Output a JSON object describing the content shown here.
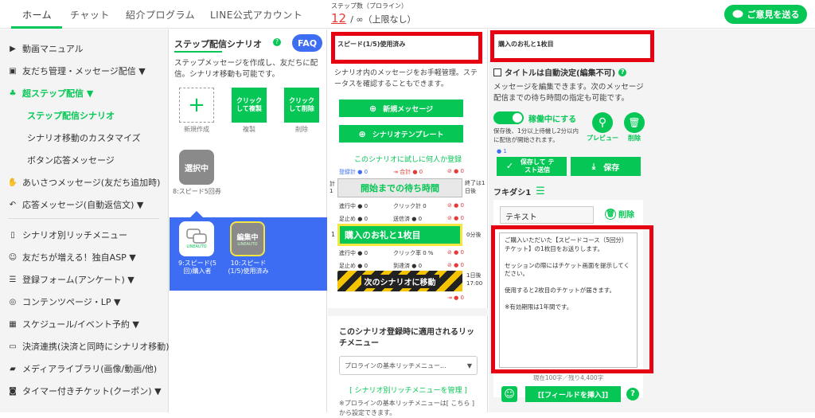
{
  "top_nav": {
    "tabs": [
      {
        "label": "ホーム"
      },
      {
        "label": "チャット"
      },
      {
        "label": "紹介プログラム"
      },
      {
        "label": "LINE公式アカウント"
      }
    ],
    "step_count": {
      "label": "ステップ数（プロライン）",
      "current": "12",
      "separator": "/ ∞（上限なし）"
    },
    "feedback_label": "ご意見を送る"
  },
  "sidebar": {
    "items": [
      {
        "label": "動画マニュアル",
        "icon": "video-icon"
      },
      {
        "label": "友だち管理・メッセージ配信 ▼",
        "icon": "contact-icon"
      },
      {
        "label": "超ステップ配信 ▼",
        "icon": "tree-icon"
      },
      {
        "label": "あいさつメッセージ(友だち追加時)",
        "icon": "hand-icon"
      },
      {
        "label": "応答メッセージ(自動返信文) ▼",
        "icon": "reply-icon"
      },
      {
        "label": "シナリオ別リッチメニュー",
        "icon": "phone-icon"
      },
      {
        "label": "友だちが増える！独自ASP ▼",
        "icon": "affiliate-icon"
      },
      {
        "label": "登録フォーム(アンケート) ▼",
        "icon": "list-icon"
      },
      {
        "label": "コンテンツページ・LP ▼",
        "icon": "globe-icon"
      },
      {
        "label": "スケジュール/イベント予約 ▼",
        "icon": "calendar-icon"
      },
      {
        "label": "決済連携(決済と同時にシナリオ移動) ▼",
        "icon": "card-icon"
      },
      {
        "label": "メディアライブラリ(画像/動画/他)",
        "icon": "folder-icon"
      },
      {
        "label": "タイマー付きチケット(クーポン) ▼",
        "icon": "ticket-icon"
      }
    ],
    "subitems": [
      {
        "label": "ステップ配信シナリオ"
      },
      {
        "label": "シナリオ移動のカスタマイズ"
      },
      {
        "label": "ボタン応答メッセージ"
      }
    ]
  },
  "scenario_panel": {
    "title": "ステップ配信シナリオ",
    "faq_label": "FAQ",
    "description": "ステップメッセージを作成し、友だちに配信。シナリオ移動も可能です。",
    "new_label": "新規作成",
    "copy_label": "クリックして複製",
    "copy_caption": "複製",
    "delete_label": "クリックして削除",
    "delete_caption": "削除",
    "selected_tile_label": "選択中",
    "selected_tile_caption": "8:スピード5回券",
    "tiles": [
      {
        "caption": "9:スピード(5回)購入者",
        "badge": "LINEAUTO"
      },
      {
        "caption": "10:スピード(1/5)使用済み",
        "badge": "LINEAUTO",
        "overlay": "編集中"
      }
    ]
  },
  "message_panel": {
    "name_value": "スピード(1/5)使用済み",
    "description": "シナリオ内のメッセージをお手軽管理。ステータスを確認することもできます。",
    "new_message_label": "新規メッセージ",
    "template_label": "シナリオテンプレート",
    "test_register_label": "このシナリオに試しに何人か登録",
    "stats_row1": {
      "registered": "登録計",
      "registered_val": "0",
      "total": "合計",
      "total_val": "0",
      "blocked_val": "0"
    },
    "wait_label": "開始までの待ち時間",
    "wait_left": "計1",
    "wait_right": "終了は1日後",
    "stats_row2": {
      "progress": "進行中",
      "progress_val": "0",
      "click": "クリック計",
      "click_val": "0",
      "blocked_val": "0"
    },
    "stats_row3": {
      "stop": "足止め",
      "stop_val": "0",
      "sent": "送信済",
      "sent_val": "0",
      "blocked_val": "0"
    },
    "step1_label": "購入のお礼と1枚目",
    "step1_left": "1",
    "step1_right": "0分後",
    "stats_row4": {
      "progress": "進行中",
      "progress_val": "0",
      "click_rate": "クリック率",
      "click_rate_val": "0 %",
      "blocked_val": "0"
    },
    "stats_row5": {
      "stop": "足止め",
      "stop_val": "0",
      "reach": "到達済",
      "reach_val": "0",
      "blocked_val": "0"
    },
    "next_scenario_label": "次のシナリオに移動",
    "next_right": "1日後17:00",
    "next_out_val": "0",
    "rich_menu_title": "このシナリオ登録時に適用されるリッチメニュー",
    "rich_menu_select": "プロラインの基本リッチメニュー...",
    "rich_menu_link": "[ シナリオ別リッチメニューを管理 ]",
    "rich_menu_note": "※プロラインの基本リッチメニューは[ こちら ]から設定できます。"
  },
  "editor_panel": {
    "title_value": "購入のお礼と1枚目",
    "auto_title_label": "タイトルは自動決定(編集不可)",
    "description": "メッセージを編集できます。次のメッセージ配信までの待ち時間の指定も可能です。",
    "active_label": "稼働中にする",
    "active_note": "保存後、1分以上待機し2分以内に配信が開始されます。",
    "preview_label": "プレビュー",
    "delete_label": "削除",
    "count_badge": "1",
    "save_test_label": "保存して テスト送信",
    "save_label": "保存",
    "bubble_label": "フキダシ1",
    "type_value": "テキスト",
    "remove_label": "削除",
    "message_body": "ご購入いただいた【スピードコース（5回分）チケット】の1枚目をお送りします。\n\nセッションの際にはチケット画面を提示してください。\n\n使用すると2枚目のチケットが届きます。\n\n※有効期限は1年間です。",
    "char_count": "現在100字／残り4,400字",
    "insert_field_label": "[[フィールドを挿入]]"
  },
  "colors": {
    "accent": "#06c755",
    "highlight": "#e60012",
    "selected_bg": "#3d6df2",
    "link": "#e53935"
  }
}
